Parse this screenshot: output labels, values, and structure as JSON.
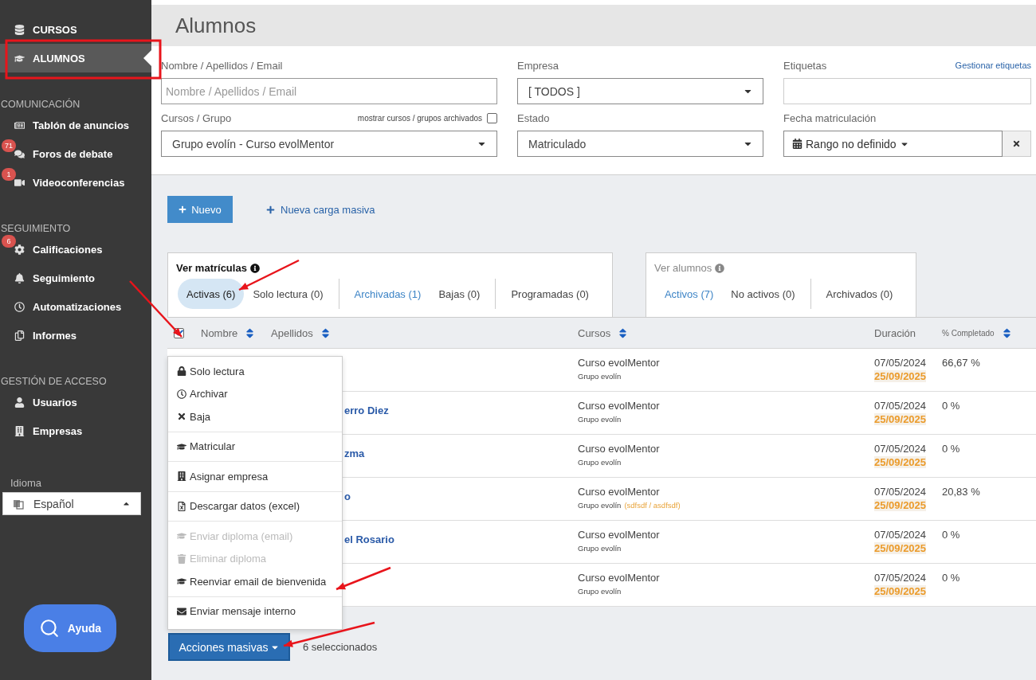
{
  "sidebar": {
    "sections": [
      {
        "items": [
          {
            "label": "CURSOS",
            "selected": false
          },
          {
            "label": "ALUMNOS",
            "selected": true
          }
        ]
      },
      {
        "title": "COMUNICACIÓN",
        "items": [
          {
            "label": "Tablón de anuncios",
            "selected": false
          },
          {
            "label": "Foros de debate",
            "badge": "71",
            "selected": false
          },
          {
            "label": "Videoconferencias",
            "badge": "1",
            "selected": false
          }
        ]
      },
      {
        "title": "SEGUIMIENTO",
        "items": [
          {
            "label": "Calificaciones",
            "badge": "6",
            "selected": false
          },
          {
            "label": "Seguimiento",
            "selected": false
          },
          {
            "label": "Automatizaciones",
            "selected": false
          },
          {
            "label": "Informes",
            "selected": false
          }
        ]
      },
      {
        "title": "GESTIÓN DE ACCESO",
        "items": [
          {
            "label": "Usuarios",
            "selected": false
          },
          {
            "label": "Empresas",
            "selected": false
          }
        ]
      }
    ],
    "language": {
      "label": "Idioma",
      "value": "Español"
    },
    "help_button": "Ayuda"
  },
  "page_title": "Alumnos",
  "filters": [
    {
      "kind": "text",
      "label": "Nombre / Apellidos / Email",
      "placeholder": "Nombre / Apellidos / Email"
    },
    {
      "kind": "select",
      "label": "Empresa",
      "value": "[ TODOS ]"
    },
    {
      "kind": "text",
      "label": "Etiquetas",
      "link": "Gestionar etiquetas"
    },
    {
      "kind": "select",
      "label": "Cursos / Grupo",
      "value": "Grupo evolín - Curso evolMentor",
      "toggle": {
        "label": "mostrar cursos / grupos archivados",
        "checked": false
      }
    },
    {
      "kind": "select",
      "label": "Estado",
      "value": "Matriculado"
    },
    {
      "kind": "daterange",
      "label": "Fecha matriculación",
      "value": "Rango no definido"
    }
  ],
  "actions": {
    "new_button": "Nuevo",
    "bulk_upload_link": "Nueva carga masiva"
  },
  "views": [
    {
      "title": "Ver matrículas",
      "tab_groups": [
        [
          {
            "label": "Activas (6)",
            "selected": true,
            "link": false
          },
          {
            "label": "Solo lectura (0)",
            "selected": false,
            "link": false
          }
        ],
        [
          {
            "label": "Archivadas (1)",
            "selected": false,
            "link": true
          },
          {
            "label": "Bajas (0)",
            "selected": false,
            "link": false
          }
        ],
        [
          {
            "label": "Programadas (0)",
            "selected": false,
            "link": false
          }
        ]
      ]
    },
    {
      "title": "Ver alumnos",
      "tab_groups": [
        [
          {
            "label": "Activos (7)",
            "selected": false,
            "link": true
          },
          {
            "label": "No activos (0)",
            "selected": false,
            "link": false
          }
        ],
        [
          {
            "label": "Archivados (0)",
            "selected": false,
            "link": false
          }
        ]
      ]
    }
  ],
  "table": {
    "select_all_checked": true,
    "columns": [
      {
        "label": "Nombre",
        "sortable": true
      },
      {
        "label": "Apellidos",
        "sortable": true
      },
      {
        "label": "Cursos",
        "sortable": true
      },
      {
        "label": "Duración",
        "sortable": false
      },
      {
        "label": "% Completado",
        "sortable": true
      }
    ],
    "rows": [
      {
        "course": "Curso evolMentor",
        "group": "Grupo evolín",
        "start": "07/05/2024",
        "end": "25/09/2025",
        "completed": "66,67 %"
      },
      {
        "name": "erro Diez",
        "course": "Curso evolMentor",
        "group": "Grupo evolín",
        "start": "07/05/2024",
        "end": "25/09/2025",
        "completed": "0 %"
      },
      {
        "name": "zma",
        "course": "Curso evolMentor",
        "group": "Grupo evolín",
        "start": "07/05/2024",
        "end": "25/09/2025",
        "completed": "0 %"
      },
      {
        "name": "o",
        "course": "Curso evolMentor",
        "group": "Grupo evolín",
        "tags": "(sdfsdf / asdfsdf)",
        "start": "07/05/2024",
        "end": "25/09/2025",
        "completed": "20,83 %"
      },
      {
        "name": "el Rosario",
        "course": "Curso evolMentor",
        "group": "Grupo evolín",
        "start": "07/05/2024",
        "end": "25/09/2025",
        "completed": "0 %"
      },
      {
        "course": "Curso evolMentor",
        "group": "Grupo evolín",
        "start": "07/05/2024",
        "end": "25/09/2025",
        "completed": "0 %"
      }
    ]
  },
  "bulk_menu": {
    "groups": [
      [
        {
          "label": "Solo lectura",
          "disabled": false
        },
        {
          "label": "Archivar",
          "disabled": false
        },
        {
          "label": "Baja",
          "disabled": false
        }
      ],
      [
        {
          "label": "Matricular",
          "disabled": false
        }
      ],
      [
        {
          "label": "Asignar empresa",
          "disabled": false
        }
      ],
      [
        {
          "label": "Descargar datos (excel)",
          "disabled": false
        }
      ],
      [
        {
          "label": "Enviar diploma (email)",
          "disabled": true
        },
        {
          "label": "Eliminar diploma",
          "disabled": true
        },
        {
          "label": "Reenviar email de bienvenida",
          "disabled": false
        }
      ],
      [
        {
          "label": "Enviar mensaje interno",
          "disabled": false
        }
      ]
    ],
    "button": "Acciones masivas",
    "selected_count": "6 seleccionados"
  }
}
